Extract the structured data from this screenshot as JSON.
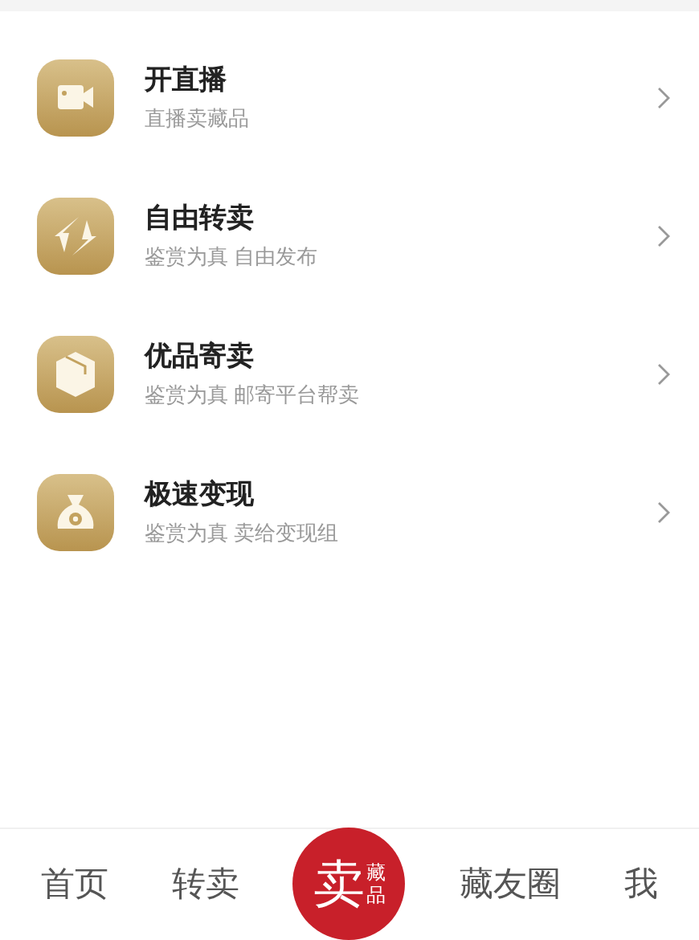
{
  "menu": [
    {
      "kind": "video",
      "title": "开直播",
      "subtitle": "直播卖藏品"
    },
    {
      "kind": "swap",
      "title": "自由转卖",
      "subtitle": "鉴赏为真 自由发布"
    },
    {
      "kind": "box",
      "title": "优品寄卖",
      "subtitle": "鉴赏为真 邮寄平台帮卖"
    },
    {
      "kind": "money",
      "title": "极速变现",
      "subtitle": "鉴赏为真 卖给变现组"
    }
  ],
  "tab_bar": [
    {
      "kind": "tab",
      "label": "首页"
    },
    {
      "kind": "tab",
      "label": "转卖"
    },
    {
      "kind": "center",
      "label": "卖",
      "sublabel": "藏品"
    },
    {
      "kind": "tab",
      "label": "藏友圈"
    },
    {
      "kind": "tab",
      "label": "我"
    }
  ]
}
